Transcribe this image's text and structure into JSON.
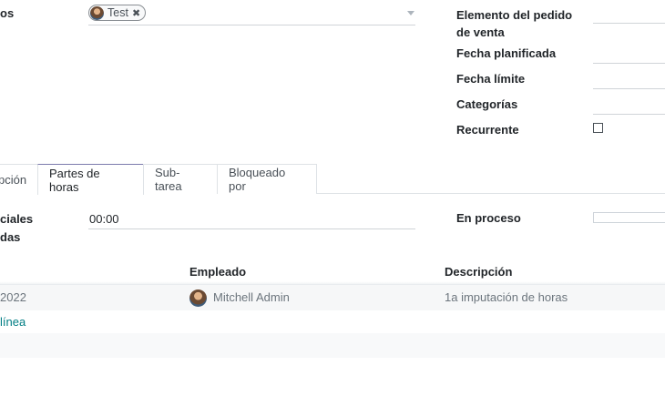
{
  "form": {
    "assignees_label_partial": "os",
    "assignee_tag": "Test",
    "sale_line_label": "Elemento del pedido de venta",
    "sale_line_label_1": "Elemento del pedido",
    "sale_line_label_2": "de venta",
    "planned_date_label": "Fecha planificada",
    "deadline_label": "Fecha límite",
    "categories_label": "Categorías",
    "recurring_label": "Recurrente",
    "recurring_checked": false
  },
  "tabs": [
    {
      "label": "pción",
      "active": false
    },
    {
      "label": "Partes de horas",
      "active": true
    },
    {
      "label": "Sub-tarea",
      "active": false
    },
    {
      "label": "Bloqueado por",
      "active": false
    }
  ],
  "timesheet": {
    "initial_label_1": "ciales",
    "initial_label_2": "das",
    "initial_value": "00:00",
    "progress_label": "En proceso"
  },
  "table": {
    "columns": {
      "date": "",
      "employee": "Empleado",
      "description": "Descripción"
    },
    "rows": [
      {
        "date": "2022",
        "employee": "Mitchell Admin",
        "description": "1a imputación de horas"
      }
    ],
    "add_line": "línea"
  }
}
